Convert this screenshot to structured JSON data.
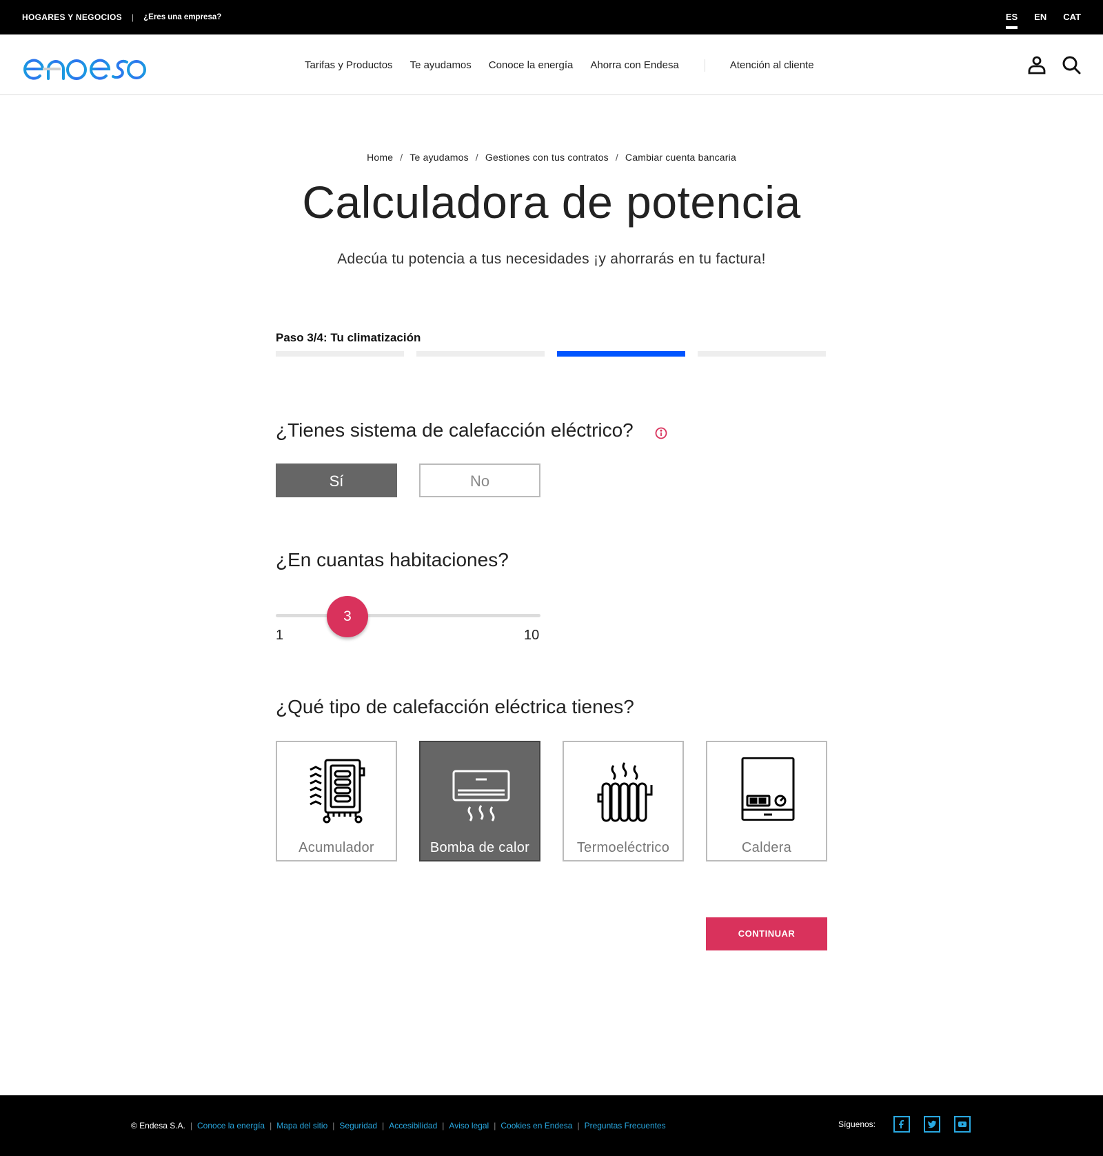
{
  "topbar": {
    "segment": "HOGARES Y NEGOCIOS",
    "company_link": "¿Eres una empresa?",
    "languages": [
      "ES",
      "EN",
      "CAT"
    ],
    "active_language": "ES"
  },
  "header": {
    "logo_text": "endesa",
    "nav": [
      "Tarifas y Productos",
      "Te ayudamos",
      "Conoce la energía",
      "Ahorra con Endesa"
    ],
    "customer_service": "Atención al cliente"
  },
  "breadcrumb": [
    "Home",
    "Te ayudamos",
    "Gestiones con tus contratos",
    "Cambiar cuenta bancaria"
  ],
  "page": {
    "title": "Calculadora de potencia",
    "subtitle": "Adecúa tu potencia a tus necesidades ¡y ahorrarás en tu factura!"
  },
  "step": {
    "label": "Paso 3/4: Tu climatización",
    "current": 3,
    "total": 4
  },
  "question_heating": {
    "text": "¿Tienes sistema de calefacción eléctrico?",
    "options": [
      "Sí",
      "No"
    ],
    "selected": "Sí"
  },
  "question_rooms": {
    "text": "¿En cuantas habitaciones?",
    "value": "3",
    "min": "1",
    "max": "10"
  },
  "question_type": {
    "text": "¿Qué tipo de calefacción eléctrica tienes?",
    "options": [
      {
        "label": "Acumulador",
        "icon": "accumulator-heater-icon"
      },
      {
        "label": "Bomba de calor",
        "icon": "heat-pump-icon"
      },
      {
        "label": "Termoeléctrico",
        "icon": "radiator-icon"
      },
      {
        "label": "Caldera",
        "icon": "boiler-icon"
      }
    ],
    "selected": "Bomba de calor"
  },
  "actions": {
    "continue_label": "CONTINUAR"
  },
  "footer": {
    "copyright": "© Endesa S.A.",
    "links": [
      "Conoce la energía",
      "Mapa del sitio",
      "Seguridad",
      "Accesibilidad",
      "Aviso legal",
      "Cookies en Endesa",
      "Preguntas Frecuentes"
    ],
    "follow_label": "Síguenos:",
    "social": [
      "facebook-icon",
      "twitter-icon",
      "youtube-icon"
    ]
  },
  "colors": {
    "accent": "#d9325c",
    "progress": "#0055ff",
    "link": "#29a8e0",
    "selected_bg": "#666666"
  }
}
